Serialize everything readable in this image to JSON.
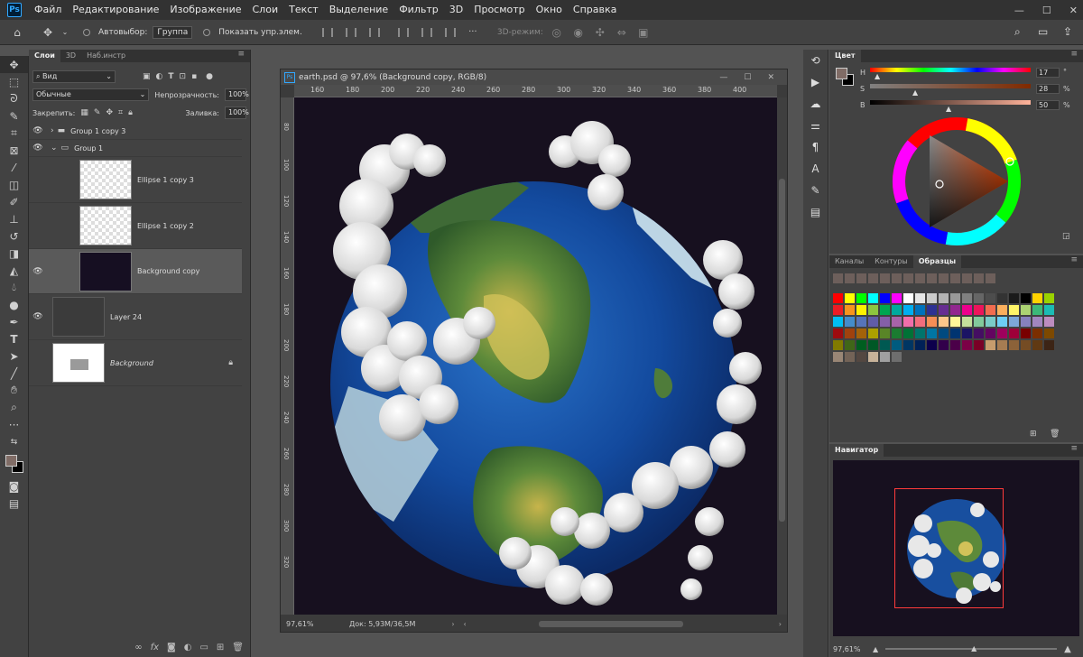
{
  "menu": {
    "app_logo": "Ps",
    "items": [
      "Файл",
      "Редактирование",
      "Изображение",
      "Слои",
      "Текст",
      "Выделение",
      "Фильтр",
      "3D",
      "Просмотр",
      "Окно",
      "Справка"
    ],
    "window_controls": [
      "—",
      "☐",
      "✕"
    ]
  },
  "options": {
    "autoselect_label": "Автовыбор:",
    "group_value": "Группа",
    "show_controls_label": "Показать упр.элем.",
    "mode3d_label": "3D-режим:"
  },
  "layers_panel": {
    "tabs": [
      "Слои",
      "3D",
      "Наб.инстр"
    ],
    "filter_kind": "Вид",
    "blend_mode": "Обычные",
    "opacity_label": "Непрозрачность:",
    "opacity_value": "100%",
    "lock_label": "Закрепить:",
    "fill_label": "Заливка:",
    "fill_value": "100%",
    "layers": [
      {
        "name": "Group 1 copy 3",
        "type": "group",
        "visible": true
      },
      {
        "name": "Group 1",
        "type": "group",
        "visible": true
      },
      {
        "name": "Ellipse 1 copy 3",
        "type": "shape",
        "visible": false
      },
      {
        "name": "Ellipse 1 copy 2",
        "type": "shape",
        "visible": false
      },
      {
        "name": "Background copy",
        "type": "pixel",
        "visible": true,
        "selected": true
      },
      {
        "name": "Layer 24",
        "type": "pixel",
        "visible": true
      },
      {
        "name": "Background",
        "type": "background",
        "visible": false
      }
    ],
    "footer_fx": "fx"
  },
  "document": {
    "title": "earth.psd @ 97,6% (Background copy, RGB/8)",
    "ruler_h": [
      "160",
      "180",
      "200",
      "220",
      "240",
      "260",
      "280",
      "300",
      "320",
      "340",
      "360",
      "380",
      "400"
    ],
    "ruler_v": [
      "80",
      "100",
      "120",
      "140",
      "160",
      "180",
      "200",
      "220",
      "240",
      "260",
      "280",
      "300",
      "320"
    ],
    "zoom": "97,61%",
    "doc_size": "Док: 5,93M/36,5M"
  },
  "color_panel": {
    "title": "Цвет",
    "labels": [
      "H",
      "S",
      "B"
    ],
    "values": [
      "17",
      "28",
      "50"
    ],
    "deg": "°",
    "pct": "%",
    "foreground": "#806c66",
    "background": "#000000"
  },
  "swatches_panel": {
    "tabs": [
      "Каналы",
      "Контуры",
      "Образцы"
    ]
  },
  "navigator_panel": {
    "title": "Навигатор",
    "zoom": "97,61%"
  }
}
